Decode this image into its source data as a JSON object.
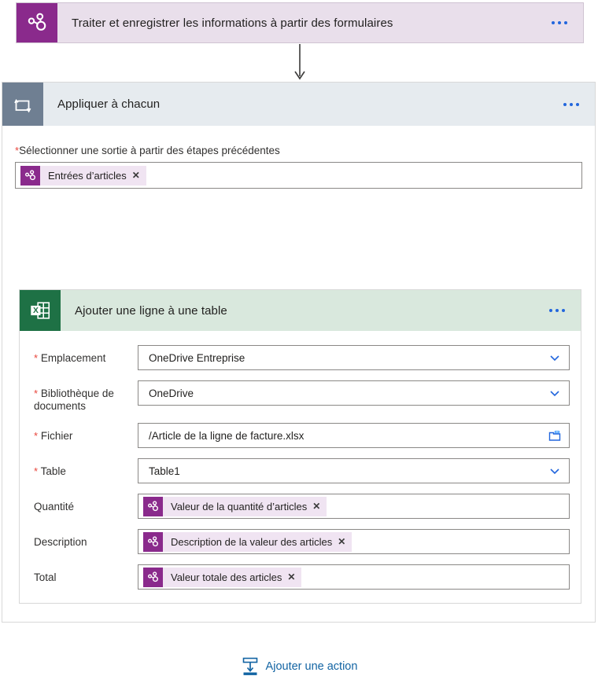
{
  "trigger": {
    "title": "Traiter et enregistrer les informations à partir des formulaires",
    "icon": "ai-builder-molecule-icon",
    "more_label": "…",
    "accent": "#8a2a8c",
    "background": "#e9dfeb"
  },
  "connector": {
    "icon": "down-arrow-icon"
  },
  "scope": {
    "title": "Appliquer à chacun",
    "icon": "loop-repeat-icon",
    "more_label": "…",
    "accent": "#6f7f92",
    "background": "#e6ebef",
    "select_output": {
      "required": true,
      "label": "Sélectionner une sortie à partir des étapes précédentes",
      "token": {
        "label": "Entrées d’articles",
        "icon": "ai-builder-molecule-icon",
        "remove_label": "✕"
      }
    }
  },
  "excel_action": {
    "title": "Ajouter une ligne à une table",
    "icon": "excel-icon",
    "more_label": "…",
    "accent": "#1e7145",
    "background": "#d9e8dd",
    "fields": [
      {
        "name": "emplacement",
        "label": "Emplacement",
        "required": true,
        "type": "select",
        "value": "OneDrive Entreprise",
        "icon": "chevron-down-icon"
      },
      {
        "name": "bibliotheque-de-documents",
        "label": "Bibliothèque de documents",
        "required": true,
        "type": "select",
        "value": "OneDrive",
        "icon": "chevron-down-icon"
      },
      {
        "name": "fichier",
        "label": "Fichier",
        "required": true,
        "type": "file",
        "value": "/Article de la ligne de facture.xlsx",
        "icon": "folder-icon"
      },
      {
        "name": "table",
        "label": "Table",
        "required": true,
        "type": "select",
        "value": "Table1",
        "icon": "chevron-down-icon"
      },
      {
        "name": "quantite",
        "label": "Quantité",
        "required": false,
        "type": "token",
        "value": "Valeur de la quantité d’articles",
        "icon": "ai-builder-molecule-icon",
        "remove_label": "✕"
      },
      {
        "name": "description",
        "label": "Description",
        "required": false,
        "type": "token",
        "value": "Description de la valeur des articles",
        "icon": "ai-builder-molecule-icon",
        "remove_label": "✕"
      },
      {
        "name": "total",
        "label": "Total",
        "required": false,
        "type": "token",
        "value": "Valeur totale des articles",
        "icon": "ai-builder-molecule-icon",
        "remove_label": "✕"
      }
    ]
  },
  "add_action": {
    "label": "Ajouter une action",
    "icon": "insert-action-icon",
    "color": "#1264a3"
  }
}
